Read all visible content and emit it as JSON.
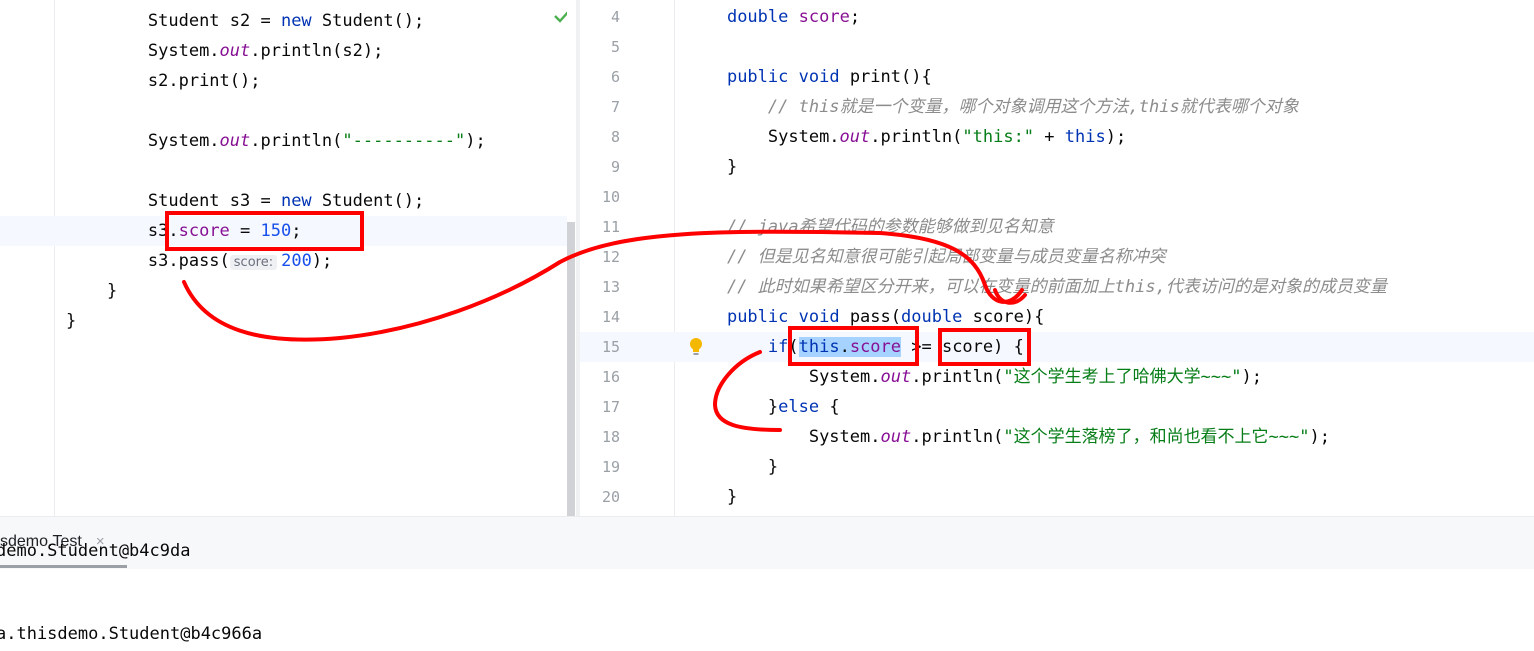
{
  "left_editor": {
    "lines": [
      {
        "indent": "        ",
        "parts": [
          {
            "t": "Student s2 = "
          },
          {
            "t": "new",
            "c": "kw"
          },
          {
            "t": " Student();"
          }
        ]
      },
      {
        "indent": "        ",
        "parts": [
          {
            "t": "System."
          },
          {
            "t": "out",
            "c": "it"
          },
          {
            "t": ".println(s2);"
          }
        ]
      },
      {
        "indent": "        ",
        "parts": [
          {
            "t": "s2.print();"
          }
        ]
      },
      {
        "indent": "",
        "parts": []
      },
      {
        "indent": "        ",
        "parts": [
          {
            "t": "System."
          },
          {
            "t": "out",
            "c": "it"
          },
          {
            "t": ".println("
          },
          {
            "t": "\"----------\"",
            "c": "str"
          },
          {
            "t": ");"
          }
        ]
      },
      {
        "indent": "",
        "parts": []
      },
      {
        "indent": "        ",
        "parts": [
          {
            "t": "Student s3 = "
          },
          {
            "t": "new",
            "c": "kw"
          },
          {
            "t": " Student();"
          }
        ]
      },
      {
        "indent": "        ",
        "parts": [
          {
            "t": "s3."
          },
          {
            "t": "score",
            "c": "fld"
          },
          {
            "t": " = "
          },
          {
            "t": "150",
            "c": "num"
          },
          {
            "t": ";"
          }
        ],
        "highlight": true
      },
      {
        "indent": "        ",
        "parts": [
          {
            "t": "s3.pass("
          },
          {
            "t": "score:",
            "c": "hint"
          },
          {
            "t": "200",
            "c": "num"
          },
          {
            "t": ");"
          }
        ]
      },
      {
        "indent": "    ",
        "parts": [
          {
            "t": "}"
          }
        ]
      },
      {
        "indent": "",
        "parts": [
          {
            "t": "}"
          }
        ]
      }
    ]
  },
  "right_editor": {
    "lines": [
      {
        "n": "4",
        "indent": "    ",
        "parts": [
          {
            "t": "double",
            "c": "kw"
          },
          {
            "t": " "
          },
          {
            "t": "score",
            "c": "fld"
          },
          {
            "t": ";"
          }
        ]
      },
      {
        "n": "5",
        "indent": "",
        "parts": []
      },
      {
        "n": "6",
        "indent": "    ",
        "parts": [
          {
            "t": "public",
            "c": "kw"
          },
          {
            "t": " "
          },
          {
            "t": "void",
            "c": "kw"
          },
          {
            "t": " print(){"
          }
        ]
      },
      {
        "n": "7",
        "indent": "        ",
        "parts": [
          {
            "t": "// this就是一个变量，哪个对象调用这个方法,this就代表哪个对象",
            "c": "cm"
          }
        ]
      },
      {
        "n": "8",
        "indent": "        ",
        "parts": [
          {
            "t": "System."
          },
          {
            "t": "out",
            "c": "it"
          },
          {
            "t": ".println("
          },
          {
            "t": "\"this:\"",
            "c": "str"
          },
          {
            "t": " + "
          },
          {
            "t": "this",
            "c": "kw"
          },
          {
            "t": ");"
          }
        ]
      },
      {
        "n": "9",
        "indent": "    ",
        "parts": [
          {
            "t": "}"
          }
        ]
      },
      {
        "n": "10",
        "indent": "",
        "parts": []
      },
      {
        "n": "11",
        "indent": "    ",
        "parts": [
          {
            "t": "// java希望代码的参数能够做到见名知意",
            "c": "cm"
          }
        ]
      },
      {
        "n": "12",
        "indent": "    ",
        "parts": [
          {
            "t": "// 但是见名知意很可能引起局部变量与成员变量名称冲突",
            "c": "cm"
          }
        ]
      },
      {
        "n": "13",
        "indent": "    ",
        "parts": [
          {
            "t": "// 此时如果希望区分开来，可以在变量的前面加上this,代表访问的是对象的成员变量",
            "c": "cm"
          }
        ]
      },
      {
        "n": "14",
        "indent": "    ",
        "parts": [
          {
            "t": "public",
            "c": "kw"
          },
          {
            "t": " "
          },
          {
            "t": "void",
            "c": "kw"
          },
          {
            "t": " pass("
          },
          {
            "t": "double",
            "c": "kw"
          },
          {
            "t": " score){"
          }
        ]
      },
      {
        "n": "15",
        "indent": "        ",
        "parts": [
          {
            "t": "if",
            "c": "kw"
          },
          {
            "t": "("
          },
          {
            "t": "this",
            "c": "kw sel"
          },
          {
            "t": ".",
            "c": "sel"
          },
          {
            "t": "score",
            "c": "fld sel"
          },
          {
            "t": " >= score) {"
          }
        ],
        "highlight": true
      },
      {
        "n": "16",
        "indent": "            ",
        "parts": [
          {
            "t": "System."
          },
          {
            "t": "out",
            "c": "it"
          },
          {
            "t": ".println("
          },
          {
            "t": "\"这个学生考上了哈佛大学~~~\"",
            "c": "str"
          },
          {
            "t": ");"
          }
        ]
      },
      {
        "n": "17",
        "indent": "        ",
        "parts": [
          {
            "t": "}"
          },
          {
            "t": "else",
            "c": "kw"
          },
          {
            "t": " {"
          }
        ]
      },
      {
        "n": "18",
        "indent": "            ",
        "parts": [
          {
            "t": "System."
          },
          {
            "t": "out",
            "c": "it"
          },
          {
            "t": ".println("
          },
          {
            "t": "\"这个学生落榜了，和尚也看不上它~~~\"",
            "c": "str"
          },
          {
            "t": ");"
          }
        ]
      },
      {
        "n": "19",
        "indent": "        ",
        "parts": [
          {
            "t": "}"
          }
        ]
      },
      {
        "n": "20",
        "indent": "    ",
        "parts": [
          {
            "t": "}"
          }
        ]
      }
    ]
  },
  "run_panel": {
    "tab_label": "sdemo.Test",
    "tab_close": "×"
  },
  "console": {
    "line_partial": "demo.Student@b4c9da",
    "line_main": "a.thisdemo.Student@b4c966a"
  },
  "colors": {
    "annotation_red": "#ff0000",
    "keyword": "#0033b3",
    "field": "#871094",
    "string": "#067d17",
    "comment": "#8c8c8c",
    "number": "#1750eb"
  },
  "icons": {
    "inspection_ok": "check-icon",
    "intention": "lightbulb-icon",
    "close_tab": "close-icon"
  }
}
